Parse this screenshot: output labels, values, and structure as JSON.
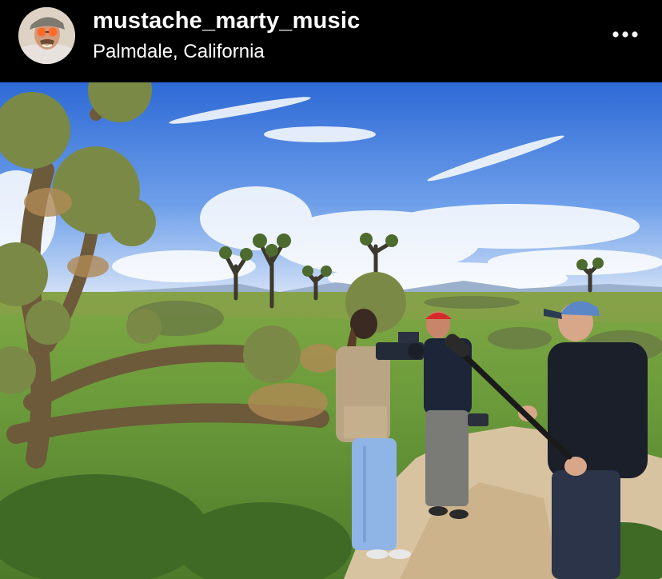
{
  "post": {
    "username": "mustache_marty_music",
    "location": "Palmdale, California",
    "more_icon": "ellipsis-horizontal-icon",
    "avatar_icon": "profile-photo"
  },
  "colors": {
    "header_bg": "#000000",
    "header_text": "#ffffff"
  }
}
